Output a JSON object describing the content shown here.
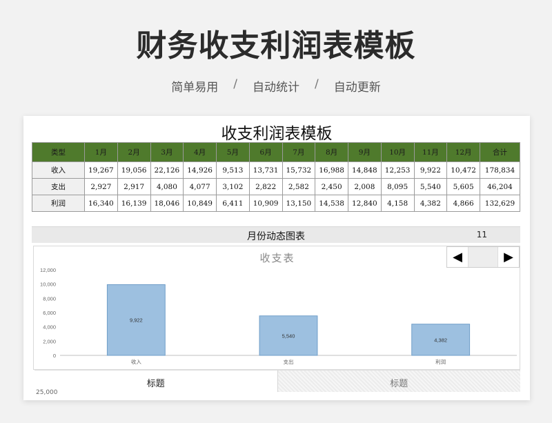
{
  "banner": {
    "title": "财务收支利润表模板",
    "tags": [
      "简单易用",
      "自动统计",
      "自动更新"
    ],
    "separator": "/"
  },
  "sheet": {
    "title": "收支利润表模板",
    "table": {
      "headers": [
        "类型",
        "1月",
        "2月",
        "3月",
        "4月",
        "5月",
        "6月",
        "7月",
        "8月",
        "9月",
        "10月",
        "11月",
        "12月",
        "合计"
      ],
      "rows": [
        [
          "收入",
          "19,267",
          "19,056",
          "22,126",
          "14,926",
          "9,513",
          "13,731",
          "15,732",
          "16,988",
          "14,848",
          "12,253",
          "9,922",
          "10,472",
          "178,834"
        ],
        [
          "支出",
          "2,927",
          "2,917",
          "4,080",
          "4,077",
          "3,102",
          "2,822",
          "2,582",
          "2,450",
          "2,008",
          "8,095",
          "5,540",
          "5,605",
          "46,204"
        ],
        [
          "利润",
          "16,340",
          "16,139",
          "18,046",
          "10,849",
          "6,411",
          "10,909",
          "13,150",
          "14,538",
          "12,840",
          "4,158",
          "4,382",
          "4,866",
          "132,629"
        ]
      ]
    },
    "section": {
      "label": "月份动态图表",
      "month_value": "11"
    },
    "spinner": {
      "prev_icon": "triangle-left-icon",
      "next_icon": "triangle-right-icon",
      "prev_glyph": "◀",
      "next_glyph": "▶"
    },
    "tabs": [
      {
        "label": "标题"
      },
      {
        "label": "标题"
      }
    ],
    "cut_axis_label": "25,000"
  },
  "chart_data": {
    "type": "bar",
    "title": "收支表",
    "categories": [
      "收入",
      "支出",
      "利润"
    ],
    "values": [
      9922,
      5540,
      4382
    ],
    "value_labels": [
      "9,922",
      "5,540",
      "4,382"
    ],
    "ylim": [
      0,
      12000
    ],
    "yticks": [
      0,
      2000,
      4000,
      6000,
      8000,
      10000,
      12000
    ],
    "ytick_labels": [
      "0",
      "2,000",
      "4,000",
      "6,000",
      "8,000",
      "10,000",
      "12,000"
    ],
    "xlabel": "",
    "ylabel": "",
    "grid": false,
    "colors": {
      "bar_fill": "#9dc0e0",
      "bar_stroke": "#6f9ec8",
      "axis": "#bfbfbf",
      "tick_text": "#666666"
    }
  }
}
